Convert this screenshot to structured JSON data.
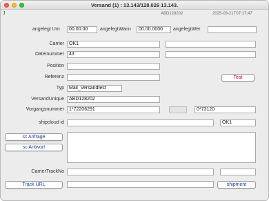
{
  "window": {
    "title": "Versand (1) : 13.143/128.026 13.143.",
    "id_text": "ABD128202",
    "timestamp": "2025-03-21T07:17:47"
  },
  "fields": {
    "angelegt_um": {
      "label": "angelegt Um",
      "value": "00:00:00"
    },
    "angelegt_wann": {
      "label": "angelegtWann",
      "value": "00.00.0000"
    },
    "angelegt_wer": {
      "label": "angelegtWer",
      "value": ""
    },
    "carrier": {
      "label": "Carrier",
      "value": "OK1",
      "extra_value": ""
    },
    "dateinummer": {
      "label": "Dateinummer",
      "value": "43",
      "extra_value": ""
    },
    "position": {
      "label": "Position",
      "value": ""
    },
    "referenz": {
      "label": "Referenz",
      "value": ""
    },
    "typ": {
      "label": "Typ",
      "value": "Mail_Versandtest"
    },
    "versand_unique": {
      "label": "VersandUnique",
      "value": "ABD128202"
    },
    "vorgangsnummer": {
      "label": "Vorgangsnummer",
      "value": "1*72206291",
      "grey_value": "",
      "extra_value": "0*73120"
    },
    "shipcloud_id": {
      "label": "shipcloud id",
      "value": "",
      "extra_value": "OK1"
    },
    "carrier_track_no": {
      "label": "CarrierTrackNo",
      "value": "",
      "extra_value": ""
    },
    "track_url": {
      "value": ""
    }
  },
  "buttons": {
    "test": "Test",
    "sc_anfrage": "sc Anfrage",
    "sc_antwort": "sc Antwort",
    "track_url": "Track URL",
    "shipment": "shipment"
  },
  "textarea": {
    "value": ""
  },
  "icons": {
    "corner": "J"
  },
  "colors": {
    "test_button_text": "#d0021b",
    "button_text": "#1a3f8f"
  }
}
